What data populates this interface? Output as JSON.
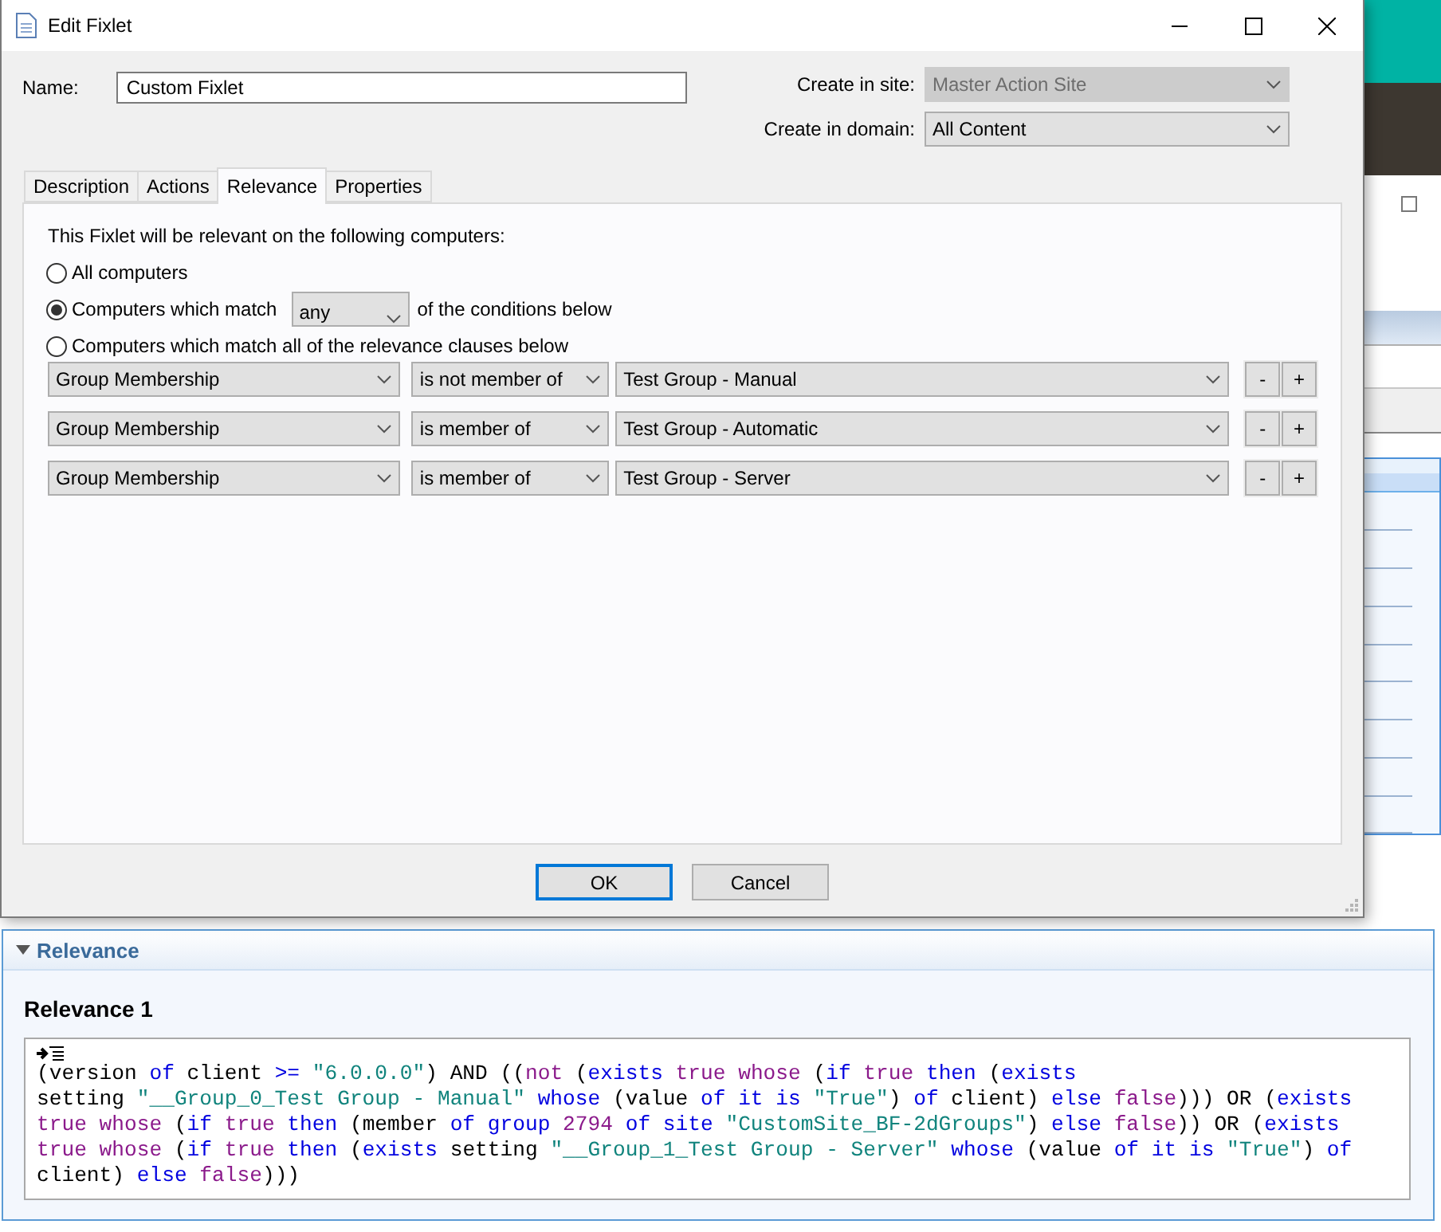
{
  "window": {
    "title": "Edit Fixlet"
  },
  "name_field": {
    "label": "Name:",
    "value": "Custom Fixlet"
  },
  "site": {
    "label": "Create in site:",
    "value": "Master Action Site",
    "disabled": true
  },
  "domain": {
    "label": "Create in domain:",
    "value": "All Content",
    "disabled": false
  },
  "tabs": [
    {
      "label": "Description",
      "selected": false
    },
    {
      "label": "Actions",
      "selected": false
    },
    {
      "label": "Relevance",
      "selected": true
    },
    {
      "label": "Properties",
      "selected": false
    }
  ],
  "relevance_tab": {
    "intro": "This Fixlet will be relevant on the following computers:",
    "options": [
      {
        "kind": "plain",
        "label": "All computers",
        "selected": false
      },
      {
        "kind": "match",
        "label": "Computers which match",
        "selected": true,
        "match_value": "any",
        "suffix": "of the conditions below"
      },
      {
        "kind": "plain",
        "label": "Computers which match all of the relevance clauses below",
        "selected": false
      }
    ],
    "conditions": [
      {
        "property": "Group Membership",
        "operator": "is not member of",
        "value": "Test Group - Manual",
        "remove": "-",
        "add": "+"
      },
      {
        "property": "Group Membership",
        "operator": "is member of",
        "value": "Test Group - Automatic",
        "remove": "-",
        "add": "+"
      },
      {
        "property": "Group Membership",
        "operator": "is member of",
        "value": "Test Group - Server",
        "remove": "-",
        "add": "+"
      }
    ]
  },
  "buttons": [
    {
      "label": "OK",
      "default": true
    },
    {
      "label": "Cancel",
      "default": false
    }
  ],
  "relevance_panel": {
    "header": "Relevance",
    "expanded": true,
    "title": "Relevance 1",
    "code": [
      {
        "kind": "plain",
        "text": "(version "
      },
      {
        "kind": "keyword",
        "text": "of "
      },
      {
        "kind": "plain",
        "text": "client "
      },
      {
        "kind": "keyword",
        "text": ">= "
      },
      {
        "kind": "string",
        "text": "\"6.0.0.0\""
      },
      {
        "kind": "plain",
        "text": ") AND (("
      },
      {
        "kind": "literal",
        "text": "not"
      },
      {
        "kind": "plain",
        "text": " ("
      },
      {
        "kind": "keyword",
        "text": "exists "
      },
      {
        "kind": "literal",
        "text": "true whose"
      },
      {
        "kind": "plain",
        "text": " ("
      },
      {
        "kind": "keyword",
        "text": "if "
      },
      {
        "kind": "literal",
        "text": "true "
      },
      {
        "kind": "keyword",
        "text": "then"
      },
      {
        "kind": "plain",
        "text": " ("
      },
      {
        "kind": "keyword",
        "text": "exists"
      },
      {
        "kind": "plain",
        "text": "\nsetting "
      },
      {
        "kind": "string",
        "text": "\"__Group_0_Test Group - Manual\" "
      },
      {
        "kind": "keyword",
        "text": "whose"
      },
      {
        "kind": "plain",
        "text": " (value "
      },
      {
        "kind": "keyword",
        "text": "of it is "
      },
      {
        "kind": "string",
        "text": "\"True\""
      },
      {
        "kind": "plain",
        "text": ") "
      },
      {
        "kind": "keyword",
        "text": "of"
      },
      {
        "kind": "plain",
        "text": " client) "
      },
      {
        "kind": "keyword",
        "text": "else "
      },
      {
        "kind": "literal",
        "text": "false"
      },
      {
        "kind": "plain",
        "text": "))) OR ("
      },
      {
        "kind": "keyword",
        "text": "exists"
      },
      {
        "kind": "literal",
        "text": "\ntrue whose"
      },
      {
        "kind": "plain",
        "text": " ("
      },
      {
        "kind": "keyword",
        "text": "if "
      },
      {
        "kind": "literal",
        "text": "true "
      },
      {
        "kind": "keyword",
        "text": "then"
      },
      {
        "kind": "plain",
        "text": " (member "
      },
      {
        "kind": "keyword",
        "text": "of group "
      },
      {
        "kind": "literal",
        "text": "2794 "
      },
      {
        "kind": "keyword",
        "text": "of site "
      },
      {
        "kind": "string",
        "text": "\"CustomSite_BF-2dGroups\""
      },
      {
        "kind": "plain",
        "text": ") "
      },
      {
        "kind": "keyword",
        "text": "else "
      },
      {
        "kind": "literal",
        "text": "false"
      },
      {
        "kind": "plain",
        "text": ")) OR ("
      },
      {
        "kind": "keyword",
        "text": "exists"
      },
      {
        "kind": "literal",
        "text": "\ntrue whose"
      },
      {
        "kind": "plain",
        "text": " ("
      },
      {
        "kind": "keyword",
        "text": "if "
      },
      {
        "kind": "literal",
        "text": "true "
      },
      {
        "kind": "keyword",
        "text": "then"
      },
      {
        "kind": "plain",
        "text": " ("
      },
      {
        "kind": "keyword",
        "text": "exists"
      },
      {
        "kind": "plain",
        "text": " setting "
      },
      {
        "kind": "string",
        "text": "\"__Group_1_Test Group - Server\" "
      },
      {
        "kind": "keyword",
        "text": "whose"
      },
      {
        "kind": "plain",
        "text": " (value "
      },
      {
        "kind": "keyword",
        "text": "of it is "
      },
      {
        "kind": "string",
        "text": "\"True\""
      },
      {
        "kind": "plain",
        "text": ") "
      },
      {
        "kind": "keyword",
        "text": "of"
      },
      {
        "kind": "plain",
        "text": "\nclient) "
      },
      {
        "kind": "keyword",
        "text": "else "
      },
      {
        "kind": "literal",
        "text": "false"
      },
      {
        "kind": "plain",
        "text": ")))"
      }
    ]
  }
}
